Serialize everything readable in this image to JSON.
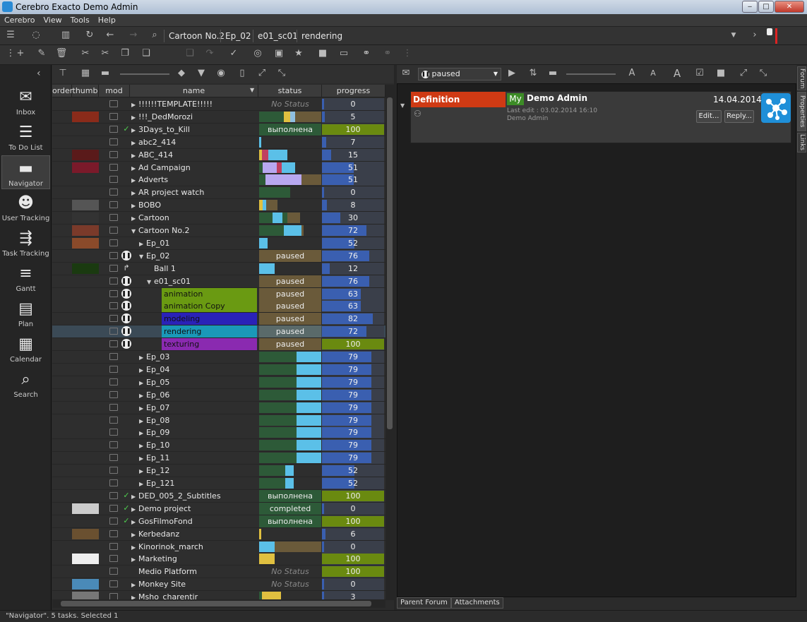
{
  "window": {
    "title": "Cerebro Exacto  Demo Admin"
  },
  "menu": [
    "Cerebro",
    "View",
    "Tools",
    "Help"
  ],
  "path": [
    "Cartoon No.2",
    "Ep_02",
    "e01_sc01",
    "rendering"
  ],
  "sidebar": [
    {
      "label": "Inbox",
      "icon": "inbox-icon",
      "glyph": "✉"
    },
    {
      "label": "To Do List",
      "icon": "todo-list-icon",
      "glyph": "☰"
    },
    {
      "label": "Navigator",
      "icon": "folder-icon",
      "glyph": "▬",
      "active": true
    },
    {
      "label": "User Tracking",
      "icon": "users-icon",
      "glyph": "☻"
    },
    {
      "label": "Task Tracking",
      "icon": "task-tracking-icon",
      "glyph": "⇶"
    },
    {
      "label": "Gantt",
      "icon": "gantt-icon",
      "glyph": "≡"
    },
    {
      "label": "Plan",
      "icon": "plan-icon",
      "glyph": "▤"
    },
    {
      "label": "Calendar",
      "icon": "calendar-icon",
      "glyph": "▦"
    },
    {
      "label": "Search",
      "icon": "search-icon",
      "glyph": "⌕"
    }
  ],
  "columns": {
    "order": "order",
    "thumb": "thumb",
    "mod": "mod",
    "name": "name",
    "status": "status",
    "progress": "progress"
  },
  "rows": [
    {
      "name": "!!!!!!TEMPLATE!!!!!",
      "level": 0,
      "exp": "r",
      "status": "No Status",
      "st_style": "nostatus",
      "progress": "0",
      "p": 0
    },
    {
      "name": "!!!_DedMorozi",
      "level": 0,
      "exp": "r",
      "thumb": "#8a2b1a",
      "st_bars": [
        [
          "#2d5a38",
          0.4
        ],
        [
          "#e0c040",
          0.1
        ],
        [
          "#8fbfe0",
          0.08
        ],
        [
          "#6a5a3a",
          0.42
        ]
      ],
      "progress": "5",
      "p": 0.05
    },
    {
      "name": "3Days_to_Kill",
      "level": 0,
      "exp": "r",
      "mk": "check",
      "status": "выполнена",
      "st_style": "done",
      "progress": "100",
      "p": 1,
      "pg_color": "#6a8a10"
    },
    {
      "name": "abc2_414",
      "level": 0,
      "exp": "r",
      "st_bars": [
        [
          "#5bc0e8",
          0.03
        ]
      ],
      "progress": "7",
      "p": 0.07
    },
    {
      "name": "ABC_414",
      "level": 0,
      "exp": "r",
      "thumb": "#5a1a1a",
      "st_bars": [
        [
          "#e0c040",
          0.05
        ],
        [
          "#c04060",
          0.1
        ],
        [
          "#5bc0e8",
          0.3
        ]
      ],
      "progress": "15",
      "p": 0.15
    },
    {
      "name": "Ad Campaign",
      "level": 0,
      "exp": "r",
      "thumb": "#7a1a2a",
      "st_bars": [
        [
          "#2d5a38",
          0.06
        ],
        [
          "#b8a8f0",
          0.22
        ],
        [
          "#c04060",
          0.08
        ],
        [
          "#5bc0e8",
          0.22
        ]
      ],
      "progress": "51",
      "p": 0.51
    },
    {
      "name": "Adverts",
      "level": 0,
      "exp": "r",
      "st_bars": [
        [
          "#2d5a38",
          0.1
        ],
        [
          "#b8a8f0",
          0.58
        ],
        [
          "#6a5a3a",
          0.32
        ]
      ],
      "progress": "51",
      "p": 0.51
    },
    {
      "name": "AR project watch",
      "level": 0,
      "exp": "r",
      "st_bars": [
        [
          "#2d5a38",
          0.5
        ]
      ],
      "progress": "0",
      "p": 0
    },
    {
      "name": "BOBO",
      "level": 0,
      "exp": "r",
      "thumb": "#555",
      "st_bars": [
        [
          "#e0c040",
          0.06
        ],
        [
          "#5bc0e8",
          0.05
        ],
        [
          "#6a5a3a",
          0.18
        ]
      ],
      "progress": "8",
      "p": 0.08
    },
    {
      "name": "Cartoon",
      "level": 0,
      "exp": "r",
      "thumb": "#333",
      "st_bars": [
        [
          "#2d5a38",
          0.22
        ],
        [
          "#5bc0e8",
          0.16
        ],
        [
          "#2d5a38",
          0.08
        ],
        [
          "#6a5a3a",
          0.2
        ]
      ],
      "progress": "30",
      "p": 0.3
    },
    {
      "name": "Cartoon No.2",
      "level": 0,
      "exp": "d",
      "thumb": "#7a3a2a",
      "st_bars": [
        [
          "#2d5a38",
          0.4
        ],
        [
          "#5bc0e8",
          0.28
        ],
        [
          "#6a5a3a",
          0.04
        ]
      ],
      "progress": "72",
      "p": 0.72
    },
    {
      "name": "Ep_01",
      "level": 1,
      "exp": "r",
      "thumb": "#8a4a2a",
      "st_bars": [
        [
          "#5bc0e8",
          0.14
        ]
      ],
      "progress": "52",
      "p": 0.52
    },
    {
      "name": "Ep_02",
      "level": 1,
      "exp": "d",
      "mk": "pause",
      "status": "paused",
      "st_style": "paused",
      "progress": "76",
      "p": 0.76
    },
    {
      "name": "Ball 1",
      "level": 2,
      "exp": "",
      "thumb": "#1a3a10",
      "mk": "arrow",
      "st_bars": [
        [
          "#5bc0e8",
          0.25
        ]
      ],
      "progress": "12",
      "p": 0.12
    },
    {
      "name": "e01_sc01",
      "level": 2,
      "exp": "d",
      "mk": "pause",
      "status": "paused",
      "st_style": "paused",
      "progress": "76",
      "p": 0.76
    },
    {
      "name": "animation",
      "level": 3,
      "exp": "",
      "mk": "pause",
      "hl": "#6a9a12",
      "status": "paused",
      "st_style": "paused",
      "progress": "63",
      "p": 0.63
    },
    {
      "name": "animation Copy",
      "level": 3,
      "exp": "",
      "mk": "pause",
      "hl": "#6a9a12",
      "status": "paused",
      "st_style": "paused",
      "progress": "63",
      "p": 0.63
    },
    {
      "name": "modeling",
      "level": 3,
      "exp": "",
      "mk": "pause",
      "hl": "#2a22b8",
      "status": "paused",
      "st_style": "paused",
      "progress": "82",
      "p": 0.82
    },
    {
      "name": "rendering",
      "level": 3,
      "exp": "",
      "mk": "pause",
      "hl": "#1a98b8",
      "status": "paused",
      "st_style": "pausedsel",
      "progress": "72",
      "p": 0.72,
      "sel": true
    },
    {
      "name": "texturing",
      "level": 3,
      "exp": "",
      "mk": "pause",
      "hl": "#8a2ab0",
      "status": "paused",
      "st_style": "paused",
      "progress": "100",
      "p": 1,
      "pg_color": "#6a8a10"
    },
    {
      "name": "Ep_03",
      "level": 1,
      "exp": "r",
      "st_bars": [
        [
          "#2d5a38",
          0.6
        ],
        [
          "#5bc0e8",
          0.4
        ]
      ],
      "progress": "79",
      "p": 0.79
    },
    {
      "name": "Ep_04",
      "level": 1,
      "exp": "r",
      "st_bars": [
        [
          "#2d5a38",
          0.6
        ],
        [
          "#5bc0e8",
          0.4
        ]
      ],
      "progress": "79",
      "p": 0.79
    },
    {
      "name": "Ep_05",
      "level": 1,
      "exp": "r",
      "st_bars": [
        [
          "#2d5a38",
          0.6
        ],
        [
          "#5bc0e8",
          0.4
        ]
      ],
      "progress": "79",
      "p": 0.79
    },
    {
      "name": "Ep_06",
      "level": 1,
      "exp": "r",
      "st_bars": [
        [
          "#2d5a38",
          0.6
        ],
        [
          "#5bc0e8",
          0.4
        ]
      ],
      "progress": "79",
      "p": 0.79
    },
    {
      "name": "Ep_07",
      "level": 1,
      "exp": "r",
      "st_bars": [
        [
          "#2d5a38",
          0.6
        ],
        [
          "#5bc0e8",
          0.4
        ]
      ],
      "progress": "79",
      "p": 0.79
    },
    {
      "name": "Ep_08",
      "level": 1,
      "exp": "r",
      "st_bars": [
        [
          "#2d5a38",
          0.6
        ],
        [
          "#5bc0e8",
          0.4
        ]
      ],
      "progress": "79",
      "p": 0.79
    },
    {
      "name": "Ep_09",
      "level": 1,
      "exp": "r",
      "st_bars": [
        [
          "#2d5a38",
          0.6
        ],
        [
          "#5bc0e8",
          0.4
        ]
      ],
      "progress": "79",
      "p": 0.79
    },
    {
      "name": "Ep_10",
      "level": 1,
      "exp": "r",
      "st_bars": [
        [
          "#2d5a38",
          0.6
        ],
        [
          "#5bc0e8",
          0.4
        ]
      ],
      "progress": "79",
      "p": 0.79
    },
    {
      "name": "Ep_11",
      "level": 1,
      "exp": "r",
      "st_bars": [
        [
          "#2d5a38",
          0.6
        ],
        [
          "#5bc0e8",
          0.4
        ]
      ],
      "progress": "79",
      "p": 0.79
    },
    {
      "name": "Ep_12",
      "level": 1,
      "exp": "r",
      "st_bars": [
        [
          "#2d5a38",
          0.42
        ],
        [
          "#5bc0e8",
          0.14
        ]
      ],
      "progress": "52",
      "p": 0.52
    },
    {
      "name": "Ep_121",
      "level": 1,
      "exp": "r",
      "st_bars": [
        [
          "#2d5a38",
          0.42
        ],
        [
          "#5bc0e8",
          0.14
        ]
      ],
      "progress": "52",
      "p": 0.52
    },
    {
      "name": "DED_005_2_Subtitles",
      "level": 0,
      "exp": "r",
      "mk": "check",
      "status": "выполнена",
      "st_style": "done",
      "progress": "100",
      "p": 1,
      "pg_color": "#6a8a10"
    },
    {
      "name": "Demo project",
      "level": 0,
      "exp": "r",
      "thumb": "#ccc",
      "mk": "check",
      "status": "completed",
      "st_style": "done",
      "progress": "0",
      "p": 0
    },
    {
      "name": "GosFilmoFond",
      "level": 0,
      "exp": "r",
      "mk": "check",
      "status": "выполнена",
      "st_style": "done",
      "progress": "100",
      "p": 1,
      "pg_color": "#6a8a10"
    },
    {
      "name": "Kerbedanz",
      "level": 0,
      "exp": "r",
      "thumb": "#6a5030",
      "st_bars": [
        [
          "#e0c040",
          0.03
        ]
      ],
      "progress": "6",
      "p": 0.06
    },
    {
      "name": "Kinorinok_march",
      "level": 0,
      "exp": "r",
      "st_bars": [
        [
          "#5bc0e8",
          0.25
        ],
        [
          "#6a5a3a",
          0.75
        ]
      ],
      "progress": "0",
      "p": 0
    },
    {
      "name": "Marketing",
      "level": 0,
      "exp": "r",
      "thumb": "#eee",
      "st_bars": [
        [
          "#e0c040",
          0.25
        ]
      ],
      "progress": "100",
      "p": 1,
      "pg_color": "#6a8a10"
    },
    {
      "name": "Medio Platform",
      "level": 0,
      "exp": "",
      "status": "No Status",
      "st_style": "nostatus",
      "progress": "100",
      "p": 1,
      "pg_color": "#6a8a10"
    },
    {
      "name": "Monkey Site",
      "level": 0,
      "exp": "r",
      "thumb": "#4a8ab8",
      "status": "No Status",
      "st_style": "nostatus",
      "progress": "0",
      "p": 0
    },
    {
      "name": "Msho_charentir",
      "level": 0,
      "exp": "r",
      "thumb": "#777",
      "st_bars": [
        [
          "#2d5a38",
          0.05
        ],
        [
          "#e0c040",
          0.3
        ]
      ],
      "progress": "3",
      "p": 0.03
    }
  ],
  "right_toolbar": {
    "status_filter": "paused"
  },
  "post": {
    "tag": "Definition",
    "my": "My",
    "author": "Demo Admin",
    "date": "14.04.2014",
    "last_edit": "Last edit : 03.02.2014 16:10",
    "byline": "Demo Admin",
    "edit_label": "Edit...",
    "reply_label": "Reply..."
  },
  "side_tabs": [
    "Forum",
    "Properties",
    "Links"
  ],
  "bottom_tabs": [
    "Parent Forum",
    "Attachments"
  ],
  "status_bar": "\"Navigator\". 5 tasks. Selected 1",
  "colors": {
    "definition": "#cf3a14",
    "my": "#3c8c26",
    "progress": "#3a5fb0",
    "done": "#2d5a38",
    "paused": "#6a5a3a"
  }
}
